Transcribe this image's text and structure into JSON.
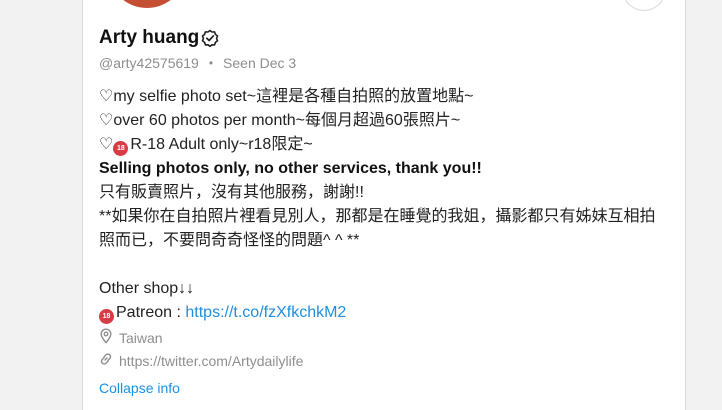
{
  "profile": {
    "name": "Arty huang",
    "handle": "@arty42575619",
    "separator": "•",
    "seen": "Seen  Dec 3"
  },
  "bio": {
    "line1": "♡my selfie photo set~這裡是各種自拍照的放置地點~",
    "line2": "♡over 60 photos per month~每個月超過60張照片~",
    "line3_prefix": "♡",
    "line3_text": "R-18 Adult only~r18限定~",
    "line4": "Selling photos only, no other services, thank you!!",
    "line5": "只有販賣照片，沒有其他服務，謝謝!!",
    "line6": "**如果你在自拍照片裡看見別人，那都是在睡覺的我姐，攝影都只有姊妹互相拍",
    "line7": "照而已，不要問奇奇怪怪的問題^ ^ **",
    "line8": "Other shop↓↓",
    "patreon_label": "Patreon : ",
    "patreon_link": "https://t.co/fzXfkchkM2",
    "emoji_text": "18"
  },
  "meta": {
    "location": "Taiwan",
    "website": "https://twitter.com/Artydailylife"
  },
  "actions": {
    "collapse": "Collapse info"
  },
  "icons": {
    "verified": "verified-badge-icon",
    "location": "location-pin-icon",
    "link": "link-icon",
    "adult": "no-under-18-icon"
  },
  "colors": {
    "link": "#1d8fe0",
    "adult_badge": "#d63c44",
    "muted": "#8e8e8e"
  }
}
